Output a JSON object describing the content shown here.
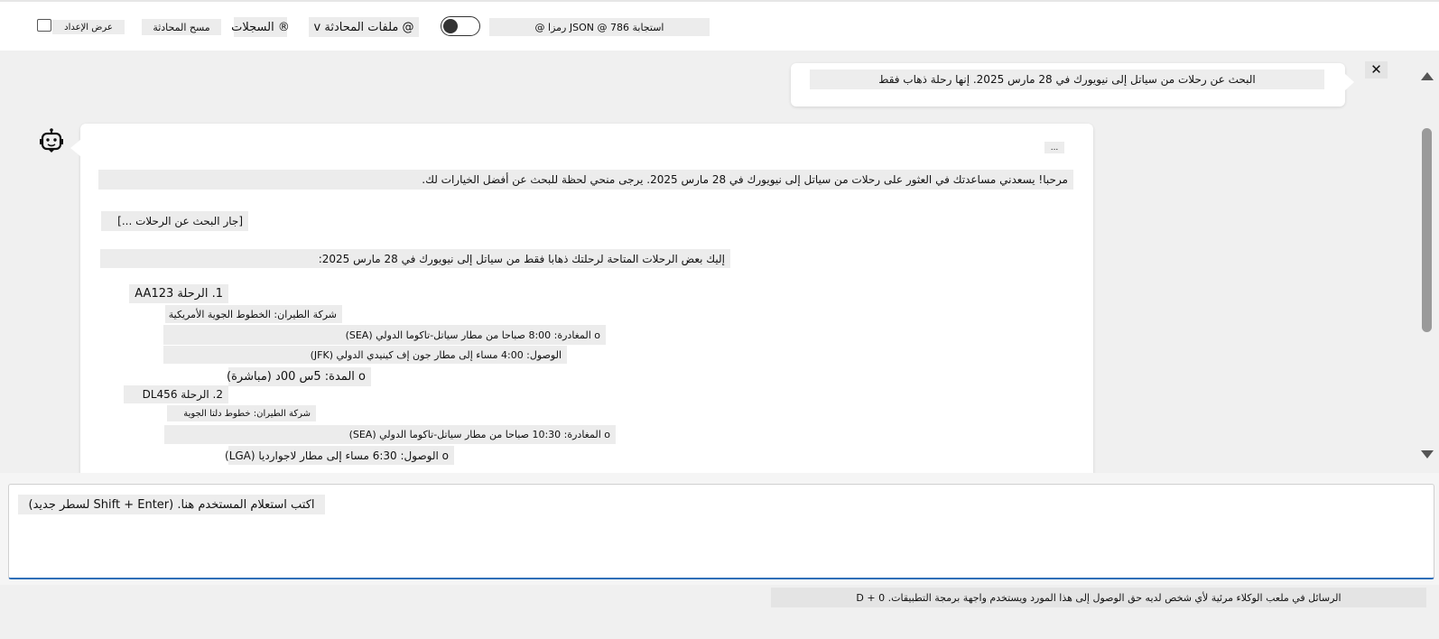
{
  "toolbar": {
    "display_settings": "عرض الإعداد",
    "clear_chat": "مسح المحادثة",
    "logs": "® السجلات",
    "chat_files": "@ ملفات المحادثة v",
    "response_format": "استجابة 786 @ JSON رمزا @"
  },
  "conversation": {
    "user_message": "البحث عن رحلات من سياتل إلى نيويورك في 28 مارس 2025. إنها رحلة ذهاب فقط",
    "close_symbol": "✕",
    "assistant": {
      "ellipsis": "...",
      "greeting": "مرحبا! يسعدني مساعدتك في العثور على رحلات من سياتل إلى نيويورك في 28 مارس 2025. يرجى منحي لحظة للبحث عن أفضل الخيارات لك.",
      "searching": "[جار البحث عن الرحلات ...]",
      "intro": "إليك بعض الرحلات المتاحة لرحلتك ذهابا فقط من سياتل إلى نيويورك في 28 مارس 2025:",
      "flights": [
        {
          "title": "1. الرحلة AA123",
          "airline": "شركة الطيران: الخطوط الجوية الأمريكية",
          "departure": "o المغادرة: 8:00 صباحا من مطار سياتل-تاكوما الدولي (SEA)",
          "arrival": "الوصول: 4:00 مساء إلى مطار جون إف كينيدي الدولي (JFK)",
          "duration": "o المدة: 5س 00د (مباشرة)"
        },
        {
          "title": "2. الرحلة DL456",
          "airline": "شركة الطيران: خطوط دلتا الجوية",
          "departure": "o المغادرة: 10:30 صباحا من مطار سياتل-تاكوما الدولي (SEA)",
          "arrival": "o الوصول: 6:30 مساء إلى مطار لاجوارديا (LGA)"
        }
      ]
    }
  },
  "composer": {
    "placeholder": "اكتب استعلام المستخدم هنا. (Shift + Enter لسطر جديد)"
  },
  "footer": {
    "notice": "الرسائل في ملعب الوكلاء مرئية لأي شخص لديه حق الوصول إلى هذا المورد ويستخدم واجهة برمجة التطبيقات. 0 + D"
  }
}
